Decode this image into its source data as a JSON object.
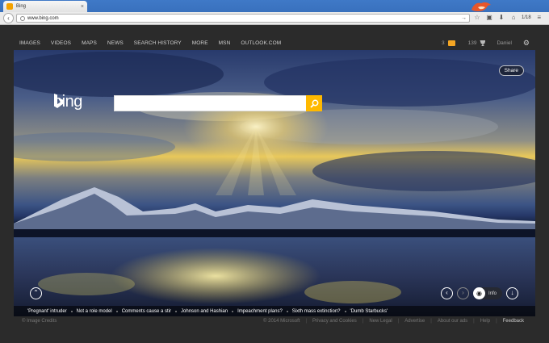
{
  "browser": {
    "tab_title": "Bing",
    "url": "www.bing.com",
    "tab_count": "1/18"
  },
  "scopes": [
    "IMAGES",
    "VIDEOS",
    "MAPS",
    "NEWS",
    "SEARCH HISTORY",
    "MORE",
    "MSN",
    "OUTLOOK.COM"
  ],
  "header": {
    "notification_count": "3",
    "rewards_points": "139",
    "user_name": "Daniel"
  },
  "logo_text": "bing",
  "search": {
    "value": "",
    "placeholder": ""
  },
  "share_label": "Share",
  "info_label": "Info",
  "headlines": [
    "'Pregnant' intruder",
    "Not a role model",
    "Comments cause a stir",
    "Johnson and Hashian",
    "Impeachment plans?",
    "Sixth mass extinction?",
    "'Dumb Starbucks'"
  ],
  "footer": {
    "credits": "© Image Credits",
    "links": [
      "© 2014 Microsoft",
      "Privacy and Cookies",
      "New Legal",
      "Advertise",
      "About our ads",
      "Help",
      "Feedback"
    ]
  },
  "colors": {
    "accent": "#ffb900",
    "chrome_blue": "#3f79c7",
    "page_bg": "#2b2b2b",
    "notification": "#f5a623"
  }
}
